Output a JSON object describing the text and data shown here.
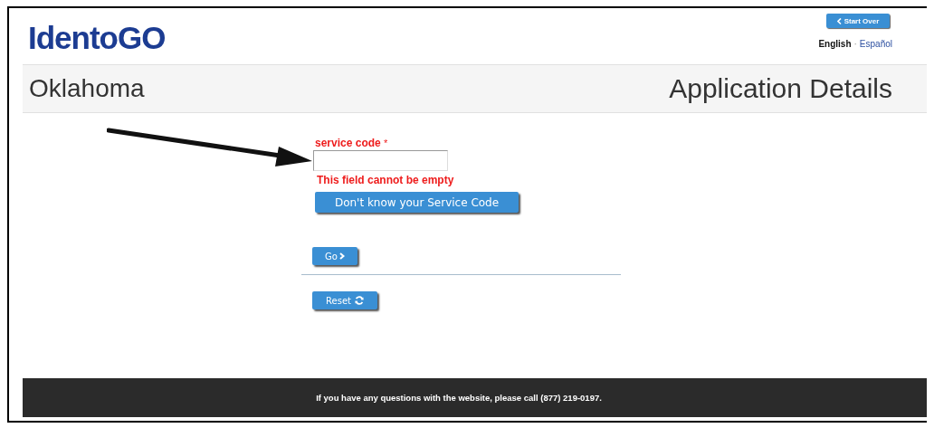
{
  "logo": "IdentoGO",
  "start_over_button": {
    "label": "Start Over"
  },
  "languages": [
    {
      "label": "English",
      "selected": true
    },
    {
      "label": "Español",
      "selected": false
    }
  ],
  "language_separator": "·",
  "header": {
    "state": "Oklahoma",
    "title": "Application Details"
  },
  "form": {
    "label": "service code",
    "required_mark": "*",
    "error": "This field cannot be empty",
    "help_button": "Don't know your Service Code",
    "go_button": "Go",
    "reset_button": "Reset"
  },
  "footer": "If you have any questions with the website, please call (877) 219-0197."
}
